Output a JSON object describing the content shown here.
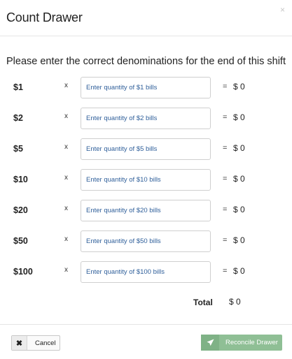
{
  "modal": {
    "title": "Count Drawer",
    "close_icon": "×"
  },
  "instruction": "Please enter the correct denominations for the end of this shift",
  "rows": [
    {
      "denomination": "$1",
      "times": "x",
      "placeholder": "Enter quantity of $1 bills",
      "equals": "=",
      "amount": "$ 0"
    },
    {
      "denomination": "$2",
      "times": "x",
      "placeholder": "Enter quantity of $2 bills",
      "equals": "=",
      "amount": "$ 0"
    },
    {
      "denomination": "$5",
      "times": "x",
      "placeholder": "Enter quantity of $5 bills",
      "equals": "=",
      "amount": "$ 0"
    },
    {
      "denomination": "$10",
      "times": "x",
      "placeholder": "Enter quantity of $10 bills",
      "equals": "=",
      "amount": "$ 0"
    },
    {
      "denomination": "$20",
      "times": "x",
      "placeholder": "Enter quantity of $20 bills",
      "equals": "=",
      "amount": "$ 0"
    },
    {
      "denomination": "$50",
      "times": "x",
      "placeholder": "Enter quantity of $50 bills",
      "equals": "=",
      "amount": "$ 0"
    },
    {
      "denomination": "$100",
      "times": "x",
      "placeholder": "Enter quantity of $100 bills",
      "equals": "=",
      "amount": "$ 0"
    }
  ],
  "total": {
    "label": "Total",
    "value": "$ 0"
  },
  "footer": {
    "cancel_icon": "✖",
    "cancel_label": "Cancel",
    "reconcile_label": "Reconcile Drawer"
  },
  "icons": {
    "close": "close-icon",
    "cancel": "x-icon",
    "reconcile": "send-icon"
  },
  "colors": {
    "reconcile_button": "#8fbf95",
    "placeholder_text": "#2f5f9a"
  }
}
